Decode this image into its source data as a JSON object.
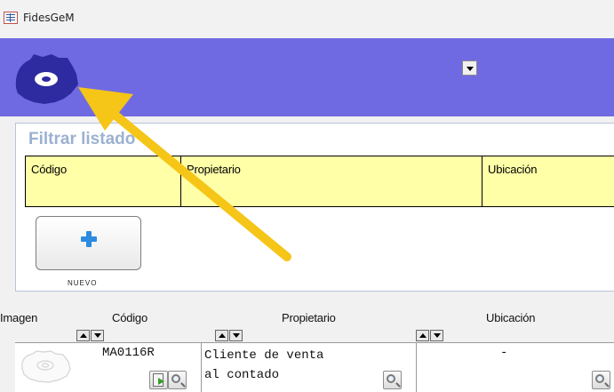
{
  "window": {
    "title": "FidesGeM"
  },
  "filter": {
    "title": "Filtrar listado",
    "columns": [
      "Código",
      "Propietario",
      "Ubicación"
    ]
  },
  "toolbar": {
    "new_label": "NUEVO"
  },
  "list": {
    "headers": [
      "Imagen",
      "Código",
      "Propietario",
      "Ubicación"
    ],
    "rows": [
      {
        "codigo": "MA0116R",
        "propietario_line1": "Cliente de venta",
        "propietario_line2": "al contado",
        "ubicacion": "-"
      }
    ]
  },
  "colors": {
    "header_band": "#6f6ae2",
    "filter_fill": "#ffffa8",
    "arrow": "#f5c518",
    "logo": "#2e2aa0"
  }
}
